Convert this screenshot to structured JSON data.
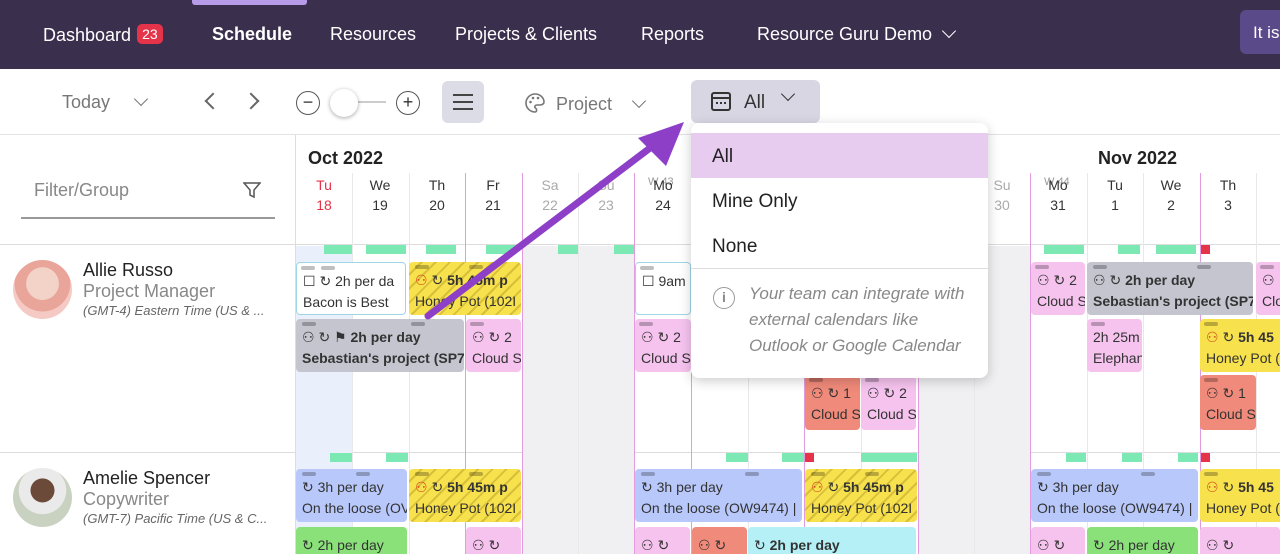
{
  "nav": {
    "dashboard": "Dashboard",
    "dashboard_badge": "23",
    "schedule": "Schedule",
    "resources": "Resources",
    "projects_clients": "Projects & Clients",
    "reports": "Reports",
    "account": "Resource Guru Demo",
    "cta": "It is"
  },
  "toolbar": {
    "today": "Today",
    "color_by": "Project",
    "calendar_filter": "All",
    "zoom_out": "−",
    "zoom_in": "+"
  },
  "dropdown": {
    "options": [
      "All",
      "Mine Only",
      "None"
    ],
    "selected": "All",
    "note": "Your team can integrate with external calendars like Outlook or Google Calendar"
  },
  "sidebar": {
    "filter_placeholder": "Filter/Group",
    "people": [
      {
        "name": "Allie Russo",
        "role": "Project Manager",
        "timezone": "(GMT-4) Eastern Time (US & ..."
      },
      {
        "name": "Amelie Spencer",
        "role": "Copywriter",
        "timezone": "(GMT-7) Pacific Time (US & C..."
      }
    ]
  },
  "calendar": {
    "months": [
      "Oct 2022",
      "Nov 2022"
    ],
    "week_labels": [
      "W 43",
      "W 44"
    ],
    "days": [
      {
        "dow": "Tu",
        "num": "18"
      },
      {
        "dow": "We",
        "num": "19"
      },
      {
        "dow": "Th",
        "num": "20"
      },
      {
        "dow": "Fr",
        "num": "21"
      },
      {
        "dow": "Sa",
        "num": "22"
      },
      {
        "dow": "Su",
        "num": "23"
      },
      {
        "dow": "Mo",
        "num": "24"
      },
      {
        "dow": "Su",
        "num": "30"
      },
      {
        "dow": "Mo",
        "num": "31"
      },
      {
        "dow": "Tu",
        "num": "1"
      },
      {
        "dow": "We",
        "num": "2"
      },
      {
        "dow": "Th",
        "num": "3"
      }
    ],
    "bookings": {
      "b1_l1": "2h per da",
      "b1_l2": "Bacon is Best",
      "b2_l1": "5h 45m p",
      "b2_l2": "Honey Pot (102I",
      "b3_l1": "9am",
      "b4_l1": "2h per day",
      "b4_l2": "Sebastian's project (SP76",
      "b5_l1": "2",
      "b5_l2": "Cloud S",
      "b6_l1": "2",
      "b6_l2": "Cloud S",
      "b7_l1": "1",
      "b7_l2": "Cloud S",
      "b8_l1": "2",
      "b8_l2": "Cloud S",
      "b9_l1": "2",
      "b9_l2": "Cloud S",
      "b10_l1": "2h per day",
      "b10_l2": "Sebastian's project (SP76",
      "b11_l1": "Clo",
      "b12_l1": "2h 25m",
      "b12_l2": "Elephan",
      "b13_l1": "5h 45",
      "b13_l2": "Honey Pot (1",
      "b14_l1": "1",
      "b14_l2": "Cloud S",
      "c1_l1": "3h per day",
      "c1_l2": "On the loose (OV",
      "c2_l1": "5h 45m p",
      "c2_l2": "Honey Pot (102I",
      "c3_l1": "3h per day",
      "c3_l2": "On the loose (OW9474) |",
      "c4_l1": "5h 45m p",
      "c4_l2": "Honey Pot (102I",
      "c5_l1": "3h per day",
      "c5_l2": "On the loose (OW9474) |",
      "c6_l1": "5h 45",
      "c6_l2": "Honey Pot (1",
      "c7_l1": "2h per day",
      "c8_l1": "2h per day",
      "c9_l1": "2h per day",
      "c10_l1": "2h per day"
    }
  },
  "colors": {
    "nav_bg": "#3b2f4e",
    "badge": "#e5334a",
    "annotation_arrow": "#8e3fc8",
    "dropdown_selected": "#e7ccef"
  }
}
